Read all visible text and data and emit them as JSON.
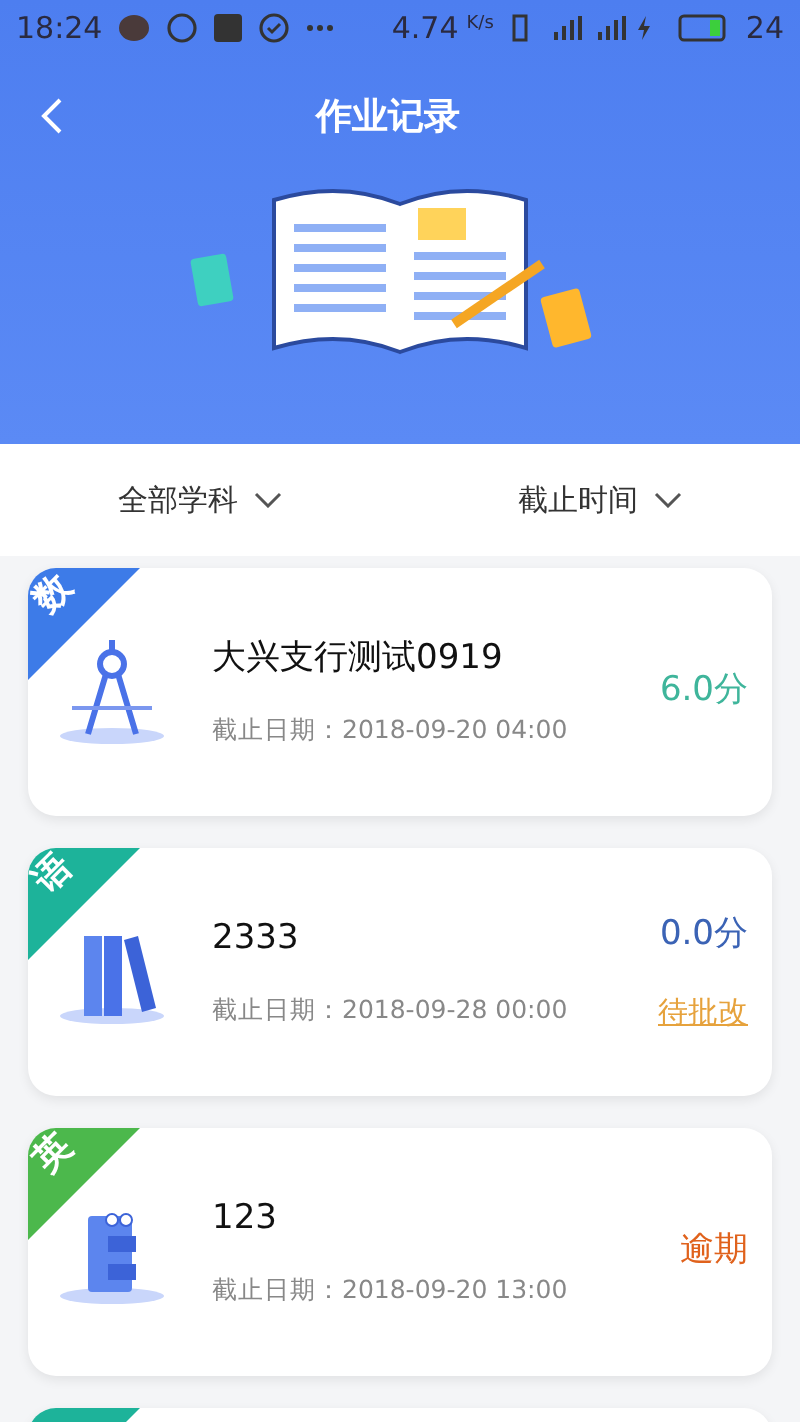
{
  "status_bar": {
    "time": "18:24",
    "speed": "4.74",
    "speed_unit": "K/s",
    "battery": "24"
  },
  "header": {
    "title": "作业记录"
  },
  "filters": [
    {
      "label": "全部学科"
    },
    {
      "label": "截止时间"
    }
  ],
  "records": [
    {
      "kind": "math",
      "subject": "数",
      "color": "#3d7be8",
      "title": "大兴支行测试0919",
      "deadline_label": "截止日期：",
      "deadline": "2018-09-20 04:00",
      "score": {
        "text": "6.0分",
        "color": "#3fb59b"
      }
    },
    {
      "kind": "chinese",
      "subject": "语",
      "color": "#1db39a",
      "title": "2333",
      "deadline_label": "截止日期：",
      "deadline": "2018-09-28 00:00",
      "score": {
        "text": "0.0分",
        "color": "#3b63b5"
      },
      "status": {
        "text": "待批改",
        "kind": "pending"
      }
    },
    {
      "kind": "english",
      "subject": "英",
      "color": "#4cb84c",
      "title": "123",
      "deadline_label": "截止日期：",
      "deadline": "2018-09-20 13:00",
      "status": {
        "text": "逾期",
        "kind": "overdue"
      }
    },
    {
      "kind": "partial",
      "color": "#1db39a"
    }
  ]
}
